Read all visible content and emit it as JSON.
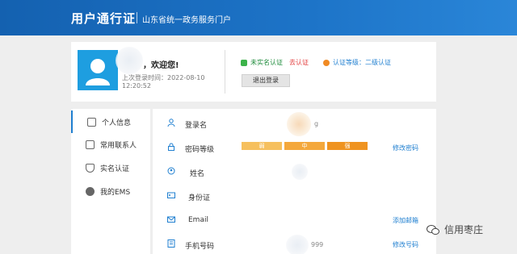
{
  "header": {
    "title": "用户通行证",
    "portal": "山东省统一政务服务门户"
  },
  "user": {
    "welcome": "，欢迎您!",
    "last_login_label": "上次登录时间：2022-08-10",
    "last_login_time": "12:20:52",
    "verify_status": "未实名认证",
    "verify_link": "去认证",
    "level": "认证等级：二级认证",
    "logout": "退出登录"
  },
  "sidebar": {
    "items": [
      {
        "label": "个人信息",
        "icon": "id-card-icon"
      },
      {
        "label": "常用联系人",
        "icon": "contacts-icon"
      },
      {
        "label": "实名认证",
        "icon": "shield-icon"
      },
      {
        "label": "我的EMS",
        "icon": "ems-icon"
      }
    ]
  },
  "profile": {
    "rows": [
      {
        "label": "登录名",
        "value": "g",
        "action": ""
      },
      {
        "label": "密码等级",
        "value": "",
        "action": "修改密码"
      },
      {
        "label": "姓名",
        "value": "",
        "action": ""
      },
      {
        "label": "身份证",
        "value": "",
        "action": ""
      },
      {
        "label": "Email",
        "value": "",
        "action": "添加邮箱"
      },
      {
        "label": "手机号码",
        "value": "999",
        "action": "修改号码"
      }
    ],
    "strength": [
      "弱",
      "中",
      "强"
    ]
  },
  "watermark": "信用枣庄",
  "colors": {
    "accent": "#1f7fd0",
    "header": "#1668b9",
    "avatar": "#1e9ee0"
  }
}
